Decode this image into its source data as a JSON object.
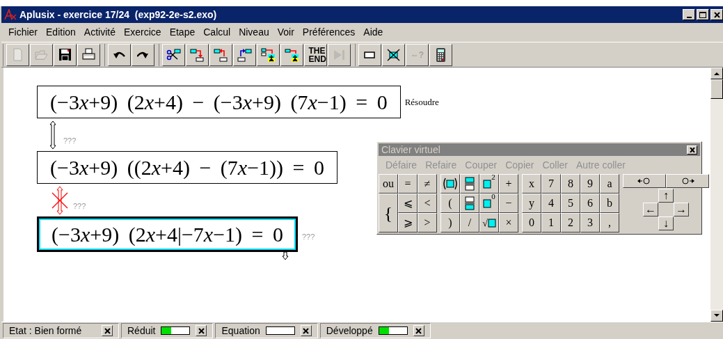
{
  "window": {
    "title": "Aplusix - exercice 17/24  (exp92-2e-s2.exo)"
  },
  "menu": [
    {
      "label": "Fichier"
    },
    {
      "label": "Edition"
    },
    {
      "label": "Activité"
    },
    {
      "label": "Exercice"
    },
    {
      "label": "Etape"
    },
    {
      "label": "Calcul"
    },
    {
      "label": "Niveau"
    },
    {
      "label": "Voir"
    },
    {
      "label": "Préférences"
    },
    {
      "label": "Aide"
    }
  ],
  "toolbar": [
    [
      {
        "kind": "new",
        "disabled": true
      },
      {
        "kind": "open",
        "disabled": true
      },
      {
        "kind": "save",
        "disabled": false
      },
      {
        "kind": "print",
        "disabled": false
      }
    ],
    [
      {
        "kind": "undo",
        "disabled": false
      },
      {
        "kind": "redo",
        "disabled": false
      }
    ],
    [
      {
        "kind": "cut-step",
        "disabled": false
      },
      {
        "kind": "step-down",
        "disabled": false
      },
      {
        "kind": "step-back",
        "disabled": false
      },
      {
        "kind": "step-up",
        "disabled": false
      },
      {
        "kind": "walk-step",
        "disabled": false
      },
      {
        "kind": "walk",
        "disabled": false
      },
      {
        "kind": "end",
        "label": "THE END",
        "disabled": false
      },
      {
        "kind": "play",
        "disabled": true
      }
    ],
    [
      {
        "kind": "box",
        "disabled": false
      },
      {
        "kind": "cross-box",
        "disabled": false
      },
      {
        "kind": "equiv",
        "label": "⇔?",
        "disabled": true
      },
      {
        "kind": "calculator",
        "disabled": false
      }
    ]
  ],
  "steps": [
    {
      "expression": "(−3x+9) (2x+4) − (−3x+9) (7x−1) = 0",
      "comment": "Résoudre",
      "selected": false
    },
    {
      "link": {
        "kind": "valid",
        "label": "???"
      },
      "expression": "(−3x+9) ((2x+4) − (7x−1)) = 0",
      "selected": false
    },
    {
      "link": {
        "kind": "invalid",
        "label": "???"
      },
      "expression": "(−3x+9) (2x+4|−7x−1) = 0",
      "comment": "???",
      "selected": true
    }
  ],
  "keyboard": {
    "title": "Clavier virtuel",
    "actions": [
      "Défaire",
      "Refaire",
      "Couper",
      "Copier",
      "Coller",
      "Autre coller"
    ],
    "groups": [
      [
        {
          "kind": "text",
          "label": "ou"
        },
        {
          "kind": "text",
          "label": "="
        },
        {
          "kind": "text",
          "label": "≠"
        },
        {
          "kind": "brace",
          "label": "{"
        },
        {
          "kind": "text",
          "label": "⩽"
        },
        {
          "kind": "text",
          "label": "<"
        },
        {
          "kind": "text",
          "label": "⩾"
        },
        {
          "kind": "text",
          "label": ">"
        }
      ],
      [
        {
          "kind": "paren-box"
        },
        {
          "kind": "frac-num"
        },
        {
          "kind": "power",
          "label": "2"
        },
        {
          "kind": "text",
          "label": "+"
        },
        {
          "kind": "text",
          "label": "("
        },
        {
          "kind": "frac-den"
        },
        {
          "kind": "power",
          "label": "0"
        },
        {
          "kind": "text",
          "label": "−"
        },
        {
          "kind": "text",
          "label": ")"
        },
        {
          "kind": "text",
          "label": "/"
        },
        {
          "kind": "sqrt",
          "label": "√"
        },
        {
          "kind": "text",
          "label": "×"
        }
      ],
      [
        {
          "kind": "text",
          "label": "x"
        },
        {
          "kind": "text",
          "label": "7"
        },
        {
          "kind": "text",
          "label": "8"
        },
        {
          "kind": "text",
          "label": "9"
        },
        {
          "kind": "text",
          "label": "a"
        },
        {
          "kind": "text",
          "label": "y"
        },
        {
          "kind": "text",
          "label": "4"
        },
        {
          "kind": "text",
          "label": "5"
        },
        {
          "kind": "text",
          "label": "6"
        },
        {
          "kind": "text",
          "label": "b"
        },
        {
          "kind": "text",
          "label": "0"
        },
        {
          "kind": "text",
          "label": "1"
        },
        {
          "kind": "text",
          "label": "2"
        },
        {
          "kind": "text",
          "label": "3"
        },
        {
          "kind": "text",
          "label": ","
        }
      ]
    ],
    "arrows": [
      "↑",
      "←",
      "→",
      "↓"
    ]
  },
  "status_bar": [
    {
      "kind": "text",
      "label": "Etat : Bien formé"
    },
    {
      "kind": "meter",
      "label": "Réduit",
      "level": 0.35
    },
    {
      "kind": "meter",
      "label": "Equation",
      "level": 0
    },
    {
      "kind": "meter",
      "label": "Développé",
      "level": 0.35
    }
  ]
}
